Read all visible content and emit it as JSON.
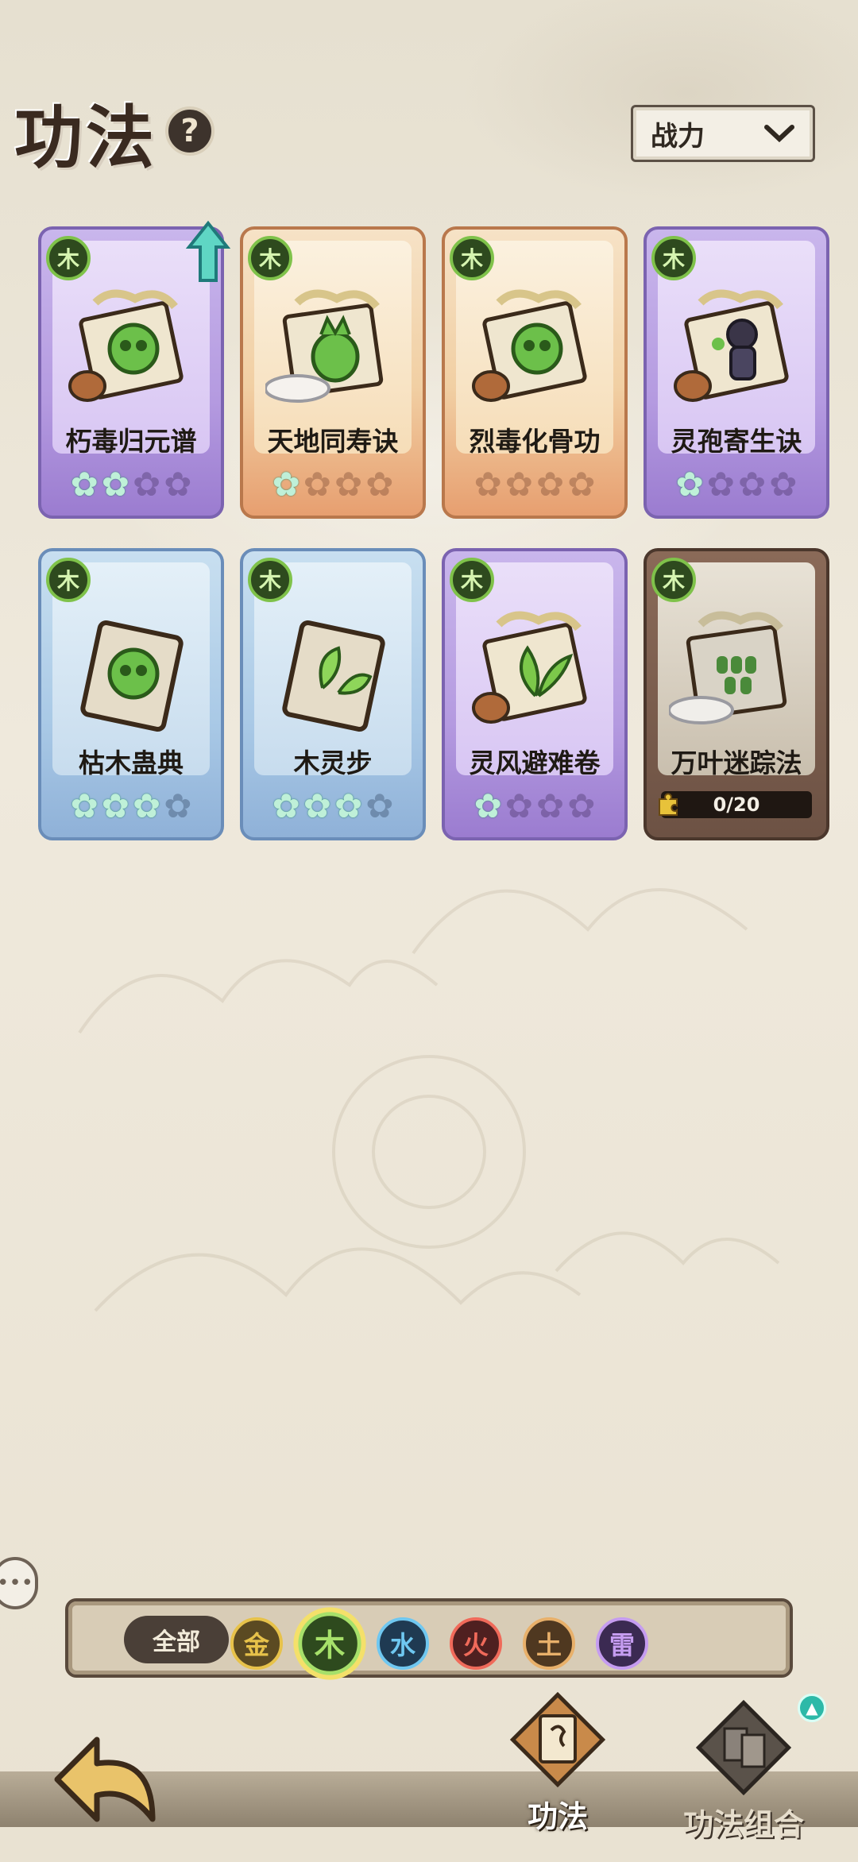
{
  "header": {
    "title": "功法",
    "help_icon": "question-mark-icon",
    "sort": {
      "selected": "战力"
    }
  },
  "cards": [
    {
      "name": "朽毒归元谱",
      "element": "木",
      "rarity": "purple",
      "stars_filled": 2,
      "stars_total": 4,
      "art": "poison-skull-scroll",
      "upgradable": true
    },
    {
      "name": "天地同寿诀",
      "element": "木",
      "rarity": "orange",
      "stars_filled": 1,
      "stars_total": 4,
      "art": "gourd-scroll"
    },
    {
      "name": "烈毒化骨功",
      "element": "木",
      "rarity": "orange",
      "stars_filled": 0,
      "stars_total": 4,
      "art": "poison-skull-scroll"
    },
    {
      "name": "灵孢寄生诀",
      "element": "木",
      "rarity": "purple",
      "stars_filled": 1,
      "stars_total": 4,
      "art": "spore-figure-scroll"
    },
    {
      "name": "枯木蛊典",
      "element": "木",
      "rarity": "blue",
      "stars_filled": 3,
      "stars_total": 4,
      "art": "skull-book"
    },
    {
      "name": "木灵步",
      "element": "木",
      "rarity": "blue",
      "stars_filled": 3,
      "stars_total": 4,
      "art": "leaf-book"
    },
    {
      "name": "灵风避难卷",
      "element": "木",
      "rarity": "purple",
      "stars_filled": 1,
      "stars_total": 4,
      "art": "leaf-scroll"
    },
    {
      "name": "万叶迷踪法",
      "element": "木",
      "rarity": "locked",
      "progress": "0/20",
      "art": "leaf-swarm-scroll"
    }
  ],
  "filter": {
    "all_label": "全部",
    "elements": [
      {
        "label": "金",
        "color": "#e7c24a",
        "bg": "#5b4a22"
      },
      {
        "label": "木",
        "color": "#a6e06a",
        "bg": "#2e4a1e",
        "active": true
      },
      {
        "label": "水",
        "color": "#6fc7f0",
        "bg": "#1f3a52"
      },
      {
        "label": "火",
        "color": "#f06a5a",
        "bg": "#4f2020"
      },
      {
        "label": "土",
        "color": "#e8b06a",
        "bg": "#4f3820"
      },
      {
        "label": "雷",
        "color": "#c59cf0",
        "bg": "#3b2a52"
      }
    ]
  },
  "nav": {
    "tab1": "功法",
    "tab2": "功法组合"
  }
}
